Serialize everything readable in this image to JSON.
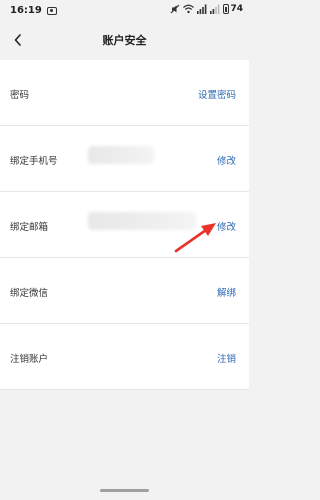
{
  "status_bar": {
    "time": "16:19",
    "battery": "74"
  },
  "header": {
    "title": "账户安全"
  },
  "rows": [
    {
      "label": "密码",
      "action": "设置密码"
    },
    {
      "label": "绑定手机号",
      "action": "修改"
    },
    {
      "label": "绑定邮箱",
      "action": "修改"
    },
    {
      "label": "绑定微信",
      "action": "解绑"
    },
    {
      "label": "注销账户",
      "action": "注销"
    }
  ],
  "colors": {
    "background": "#f2f2f2",
    "card": "#ffffff",
    "action_link": "#2a69b3",
    "annotation_arrow": "#e8332a"
  }
}
